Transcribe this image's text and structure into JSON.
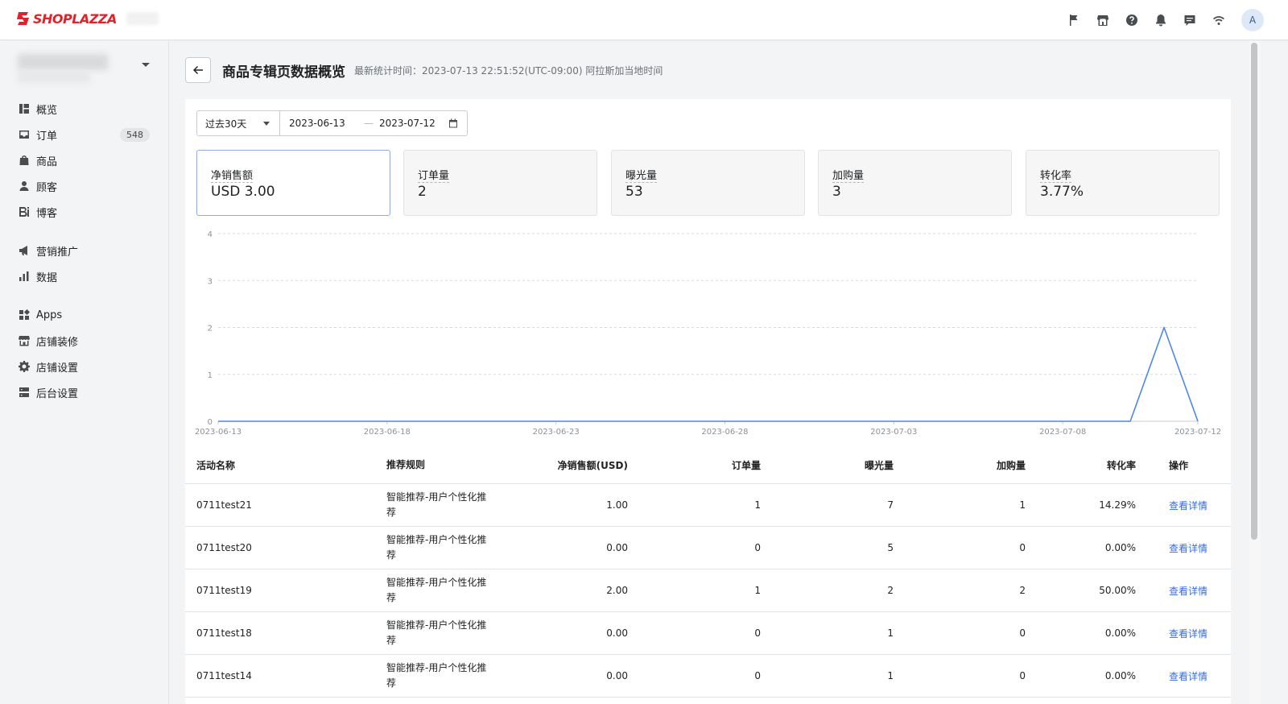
{
  "brand": {
    "name": "SHOPLAZZA",
    "color": "#e0222a"
  },
  "topbar": {
    "icons": [
      "flag-icon",
      "store-icon",
      "help-icon",
      "bell-icon",
      "chat-icon",
      "wifi-icon"
    ],
    "avatar_letter": "A"
  },
  "sidebar": {
    "items": [
      {
        "label": "概览",
        "icon": "dashboard-icon"
      },
      {
        "label": "订单",
        "icon": "inbox-icon",
        "badge": "548"
      },
      {
        "label": "商品",
        "icon": "bag-icon"
      },
      {
        "label": "顾客",
        "icon": "person-icon"
      },
      {
        "label": "博客",
        "icon": "blog-icon"
      },
      {
        "label": "营销推广",
        "icon": "megaphone-icon"
      },
      {
        "label": "数据",
        "icon": "bar-chart-icon"
      },
      {
        "label": "Apps",
        "icon": "apps-icon"
      },
      {
        "label": "店铺装修",
        "icon": "storefront-icon"
      },
      {
        "label": "店铺设置",
        "icon": "gear-icon"
      },
      {
        "label": "后台设置",
        "icon": "server-icon"
      }
    ]
  },
  "header": {
    "title": "商品专辑页数据概览",
    "subtitle": "最新统计时间：2023-07-13 22:51:52(UTC-09:00) 阿拉斯加当地时间"
  },
  "filters": {
    "range": "过去30天",
    "start_date": "2023-06-13",
    "end_date": "2023-07-12",
    "separator": "—"
  },
  "metrics": [
    {
      "label": "净销售额",
      "value": "USD 3.00",
      "active": true
    },
    {
      "label": "订单量",
      "value": "2"
    },
    {
      "label": "曝光量",
      "value": "53"
    },
    {
      "label": "加购量",
      "value": "3"
    },
    {
      "label": "转化率",
      "value": "3.77%"
    }
  ],
  "chart_data": {
    "type": "line",
    "title": "",
    "xlabel": "",
    "ylabel": "",
    "x": [
      "2023-06-13",
      "2023-06-14",
      "2023-06-15",
      "2023-06-16",
      "2023-06-17",
      "2023-06-18",
      "2023-06-19",
      "2023-06-20",
      "2023-06-21",
      "2023-06-22",
      "2023-06-23",
      "2023-06-24",
      "2023-06-25",
      "2023-06-26",
      "2023-06-27",
      "2023-06-28",
      "2023-06-29",
      "2023-06-30",
      "2023-07-01",
      "2023-07-02",
      "2023-07-03",
      "2023-07-04",
      "2023-07-05",
      "2023-07-06",
      "2023-07-07",
      "2023-07-08",
      "2023-07-09",
      "2023-07-10",
      "2023-07-11",
      "2023-07-12"
    ],
    "x_ticks": [
      "2023-06-13",
      "2023-06-18",
      "2023-06-23",
      "2023-06-28",
      "2023-07-03",
      "2023-07-08",
      "2023-07-12"
    ],
    "y_ticks": [
      0,
      1,
      2,
      3,
      4
    ],
    "ylim": [
      0,
      4
    ],
    "grid": true,
    "series": [
      {
        "values": [
          0,
          0,
          0,
          0,
          0,
          0,
          0,
          0,
          0,
          0,
          0,
          0,
          0,
          0,
          0,
          0,
          0,
          0,
          0,
          0,
          0,
          0,
          0,
          0,
          0,
          0,
          0,
          0,
          2,
          0
        ],
        "color": "#4e86f0"
      }
    ]
  },
  "table": {
    "headers": [
      "活动名称",
      "推荐规则",
      "净销售额(USD)",
      "订单量",
      "曝光量",
      "加购量",
      "转化率",
      "操作"
    ],
    "rows": [
      {
        "name": "0711test21",
        "rule": "智能推荐-用户个性化推荐",
        "sales": "1.00",
        "orders": "1",
        "impressions": "7",
        "cart": "1",
        "conversion": "14.29%",
        "action": "查看详情"
      },
      {
        "name": "0711test20",
        "rule": "智能推荐-用户个性化推荐",
        "sales": "0.00",
        "orders": "0",
        "impressions": "5",
        "cart": "0",
        "conversion": "0.00%",
        "action": "查看详情"
      },
      {
        "name": "0711test19",
        "rule": "智能推荐-用户个性化推荐",
        "sales": "2.00",
        "orders": "1",
        "impressions": "2",
        "cart": "2",
        "conversion": "50.00%",
        "action": "查看详情"
      },
      {
        "name": "0711test18",
        "rule": "智能推荐-用户个性化推荐",
        "sales": "0.00",
        "orders": "0",
        "impressions": "1",
        "cart": "0",
        "conversion": "0.00%",
        "action": "查看详情"
      },
      {
        "name": "0711test14",
        "rule": "智能推荐-用户个性化推荐",
        "sales": "0.00",
        "orders": "0",
        "impressions": "1",
        "cart": "0",
        "conversion": "0.00%",
        "action": "查看详情"
      }
    ]
  }
}
